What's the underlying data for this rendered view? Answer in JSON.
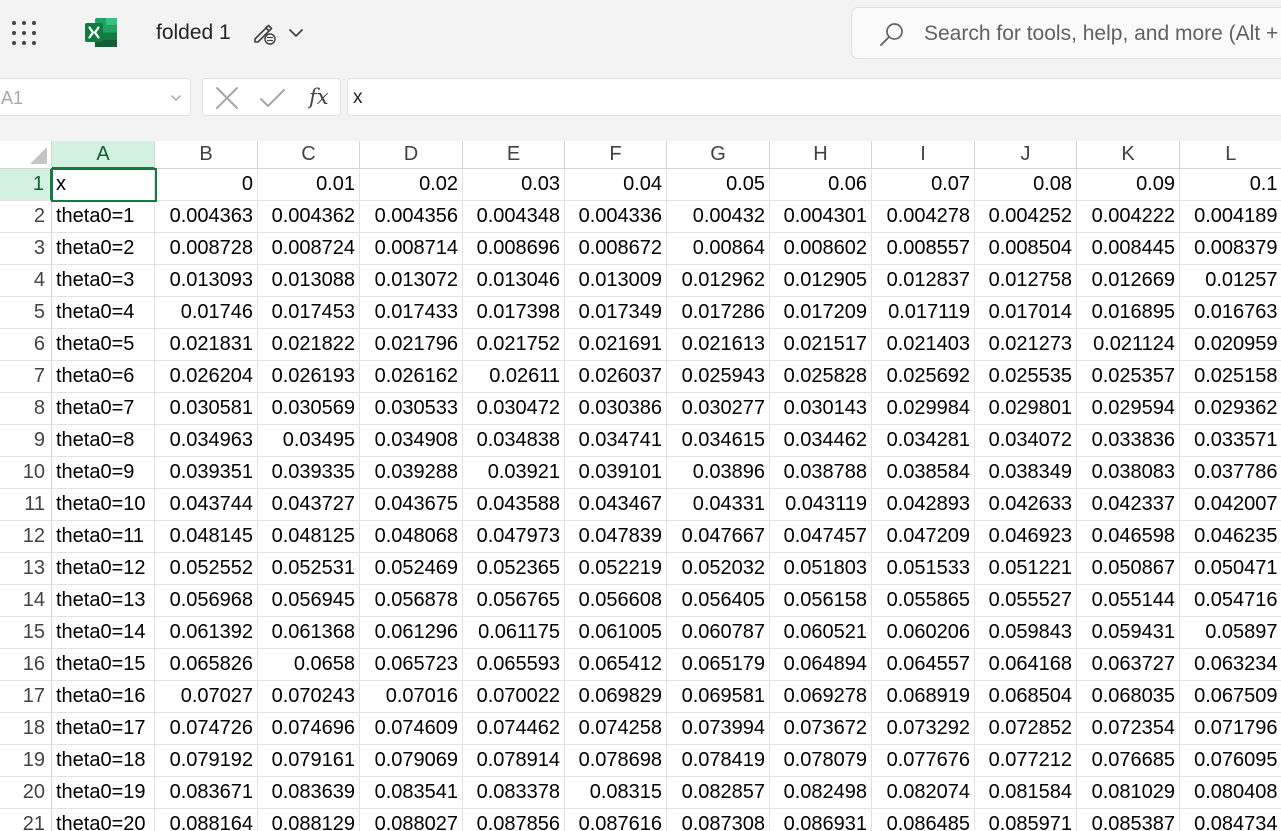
{
  "app": {
    "doc_title": "folded 1",
    "search_placeholder": "Search for tools, help, and more (Alt + Q)",
    "name_box": "A1",
    "fx_label": "fx",
    "formula_value": "x",
    "colors": {
      "accent": "#107c41",
      "header_selected": "#d3f0e0",
      "excel_green": "#185c37"
    }
  },
  "grid": {
    "columns": [
      "A",
      "B",
      "C",
      "D",
      "E",
      "F",
      "G",
      "H",
      "I",
      "J",
      "K",
      "L"
    ],
    "rows": [
      {
        "num": "1",
        "cells": [
          "x",
          "0",
          "0.01",
          "0.02",
          "0.03",
          "0.04",
          "0.05",
          "0.06",
          "0.07",
          "0.08",
          "0.09",
          "0.1"
        ]
      },
      {
        "num": "2",
        "cells": [
          "theta0=1",
          "0.004363",
          "0.004362",
          "0.004356",
          "0.004348",
          "0.004336",
          "0.00432",
          "0.004301",
          "0.004278",
          "0.004252",
          "0.004222",
          "0.004189"
        ]
      },
      {
        "num": "3",
        "cells": [
          "theta0=2",
          "0.008728",
          "0.008724",
          "0.008714",
          "0.008696",
          "0.008672",
          "0.00864",
          "0.008602",
          "0.008557",
          "0.008504",
          "0.008445",
          "0.008379"
        ]
      },
      {
        "num": "4",
        "cells": [
          "theta0=3",
          "0.013093",
          "0.013088",
          "0.013072",
          "0.013046",
          "0.013009",
          "0.012962",
          "0.012905",
          "0.012837",
          "0.012758",
          "0.012669",
          "0.01257"
        ]
      },
      {
        "num": "5",
        "cells": [
          "theta0=4",
          "0.01746",
          "0.017453",
          "0.017433",
          "0.017398",
          "0.017349",
          "0.017286",
          "0.017209",
          "0.017119",
          "0.017014",
          "0.016895",
          "0.016763"
        ]
      },
      {
        "num": "6",
        "cells": [
          "theta0=5",
          "0.021831",
          "0.021822",
          "0.021796",
          "0.021752",
          "0.021691",
          "0.021613",
          "0.021517",
          "0.021403",
          "0.021273",
          "0.021124",
          "0.020959"
        ]
      },
      {
        "num": "7",
        "cells": [
          "theta0=6",
          "0.026204",
          "0.026193",
          "0.026162",
          "0.02611",
          "0.026037",
          "0.025943",
          "0.025828",
          "0.025692",
          "0.025535",
          "0.025357",
          "0.025158"
        ]
      },
      {
        "num": "8",
        "cells": [
          "theta0=7",
          "0.030581",
          "0.030569",
          "0.030533",
          "0.030472",
          "0.030386",
          "0.030277",
          "0.030143",
          "0.029984",
          "0.029801",
          "0.029594",
          "0.029362"
        ]
      },
      {
        "num": "9",
        "cells": [
          "theta0=8",
          "0.034963",
          "0.03495",
          "0.034908",
          "0.034838",
          "0.034741",
          "0.034615",
          "0.034462",
          "0.034281",
          "0.034072",
          "0.033836",
          "0.033571"
        ]
      },
      {
        "num": "10",
        "cells": [
          "theta0=9",
          "0.039351",
          "0.039335",
          "0.039288",
          "0.03921",
          "0.039101",
          "0.03896",
          "0.038788",
          "0.038584",
          "0.038349",
          "0.038083",
          "0.037786"
        ]
      },
      {
        "num": "11",
        "cells": [
          "theta0=10",
          "0.043744",
          "0.043727",
          "0.043675",
          "0.043588",
          "0.043467",
          "0.04331",
          "0.043119",
          "0.042893",
          "0.042633",
          "0.042337",
          "0.042007"
        ]
      },
      {
        "num": "12",
        "cells": [
          "theta0=11",
          "0.048145",
          "0.048125",
          "0.048068",
          "0.047973",
          "0.047839",
          "0.047667",
          "0.047457",
          "0.047209",
          "0.046923",
          "0.046598",
          "0.046235"
        ]
      },
      {
        "num": "13",
        "cells": [
          "theta0=12",
          "0.052552",
          "0.052531",
          "0.052469",
          "0.052365",
          "0.052219",
          "0.052032",
          "0.051803",
          "0.051533",
          "0.051221",
          "0.050867",
          "0.050471"
        ]
      },
      {
        "num": "14",
        "cells": [
          "theta0=13",
          "0.056968",
          "0.056945",
          "0.056878",
          "0.056765",
          "0.056608",
          "0.056405",
          "0.056158",
          "0.055865",
          "0.055527",
          "0.055144",
          "0.054716"
        ]
      },
      {
        "num": "15",
        "cells": [
          "theta0=14",
          "0.061392",
          "0.061368",
          "0.061296",
          "0.061175",
          "0.061005",
          "0.060787",
          "0.060521",
          "0.060206",
          "0.059843",
          "0.059431",
          "0.05897"
        ]
      },
      {
        "num": "16",
        "cells": [
          "theta0=15",
          "0.065826",
          "0.0658",
          "0.065723",
          "0.065593",
          "0.065412",
          "0.065179",
          "0.064894",
          "0.064557",
          "0.064168",
          "0.063727",
          "0.063234"
        ]
      },
      {
        "num": "17",
        "cells": [
          "theta0=16",
          "0.07027",
          "0.070243",
          "0.07016",
          "0.070022",
          "0.069829",
          "0.069581",
          "0.069278",
          "0.068919",
          "0.068504",
          "0.068035",
          "0.067509"
        ]
      },
      {
        "num": "18",
        "cells": [
          "theta0=17",
          "0.074726",
          "0.074696",
          "0.074609",
          "0.074462",
          "0.074258",
          "0.073994",
          "0.073672",
          "0.073292",
          "0.072852",
          "0.072354",
          "0.071796"
        ]
      },
      {
        "num": "19",
        "cells": [
          "theta0=18",
          "0.079192",
          "0.079161",
          "0.079069",
          "0.078914",
          "0.078698",
          "0.078419",
          "0.078079",
          "0.077676",
          "0.077212",
          "0.076685",
          "0.076095"
        ]
      },
      {
        "num": "20",
        "cells": [
          "theta0=19",
          "0.083671",
          "0.083639",
          "0.083541",
          "0.083378",
          "0.08315",
          "0.082857",
          "0.082498",
          "0.082074",
          "0.081584",
          "0.081029",
          "0.080408"
        ]
      },
      {
        "num": "21",
        "cells": [
          "theta0=20",
          "0.088164",
          "0.088129",
          "0.088027",
          "0.087856",
          "0.087616",
          "0.087308",
          "0.086931",
          "0.086485",
          "0.085971",
          "0.085387",
          "0.084734"
        ]
      }
    ]
  }
}
